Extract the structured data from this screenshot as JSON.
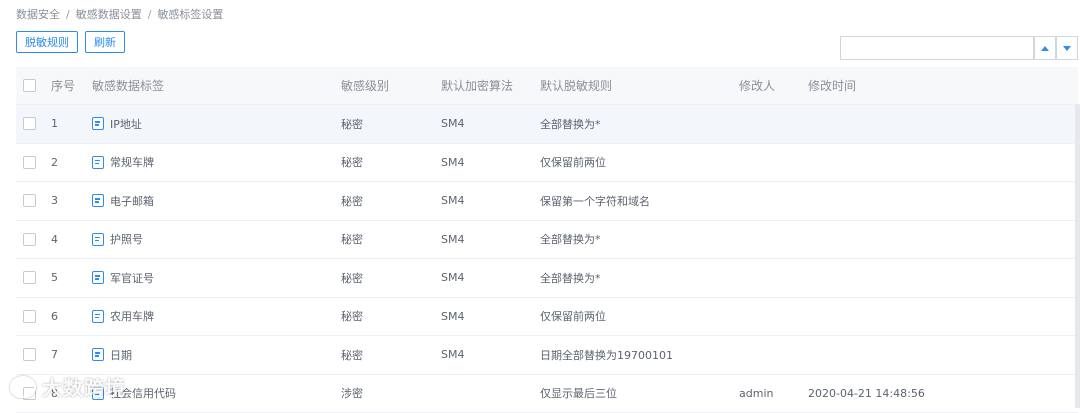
{
  "breadcrumb": [
    "数据安全",
    "敏感数据设置",
    "敏感标签设置"
  ],
  "breadcrumb_separator": "/",
  "toolbar": {
    "desensitize_rules_label": "脱敏规则",
    "refresh_label": "刷新"
  },
  "search": {
    "value": "",
    "placeholder": ""
  },
  "table": {
    "columns": {
      "no": "序号",
      "tag": "敏感数据标签",
      "level": "敏感级别",
      "algorithm": "默认加密算法",
      "rule": "默认脱敏规则",
      "modifier": "修改人",
      "modified_time": "修改时间"
    },
    "rows": [
      {
        "no": "1",
        "tag": "IP地址",
        "level": "秘密",
        "algorithm": "SM4",
        "rule": "全部替换为*",
        "modifier": "",
        "time": ""
      },
      {
        "no": "2",
        "tag": "常规车牌",
        "level": "秘密",
        "algorithm": "SM4",
        "rule": "仅保留前两位",
        "modifier": "",
        "time": ""
      },
      {
        "no": "3",
        "tag": "电子邮箱",
        "level": "秘密",
        "algorithm": "SM4",
        "rule": "保留第一个字符和域名",
        "modifier": "",
        "time": ""
      },
      {
        "no": "4",
        "tag": "护照号",
        "level": "秘密",
        "algorithm": "SM4",
        "rule": "全部替换为*",
        "modifier": "",
        "time": ""
      },
      {
        "no": "5",
        "tag": "军官证号",
        "level": "秘密",
        "algorithm": "SM4",
        "rule": "全部替换为*",
        "modifier": "",
        "time": ""
      },
      {
        "no": "6",
        "tag": "农用车牌",
        "level": "秘密",
        "algorithm": "SM4",
        "rule": "仅保留前两位",
        "modifier": "",
        "time": ""
      },
      {
        "no": "7",
        "tag": "日期",
        "level": "秘密",
        "algorithm": "SM4",
        "rule": "日期全部替换为19700101",
        "modifier": "",
        "time": ""
      },
      {
        "no": "8",
        "tag": "社会信用代码",
        "level": "涉密",
        "algorithm": "",
        "rule": "仅显示最后三位",
        "modifier": "admin",
        "time": "2020-04-21 14:48:56"
      }
    ]
  },
  "watermark": {
    "text": "大数跨境"
  },
  "colors": {
    "accent": "#2d8cf0",
    "header_bg": "#f7f8fa",
    "selected_row_bg": "#f3f6fb"
  }
}
